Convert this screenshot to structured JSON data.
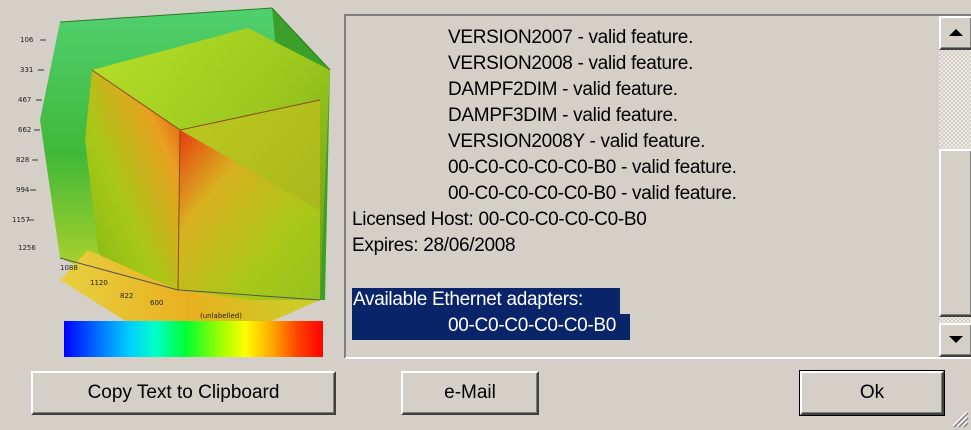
{
  "license_lines": [
    "VERSION2007 - valid feature.",
    "VERSION2008 - valid feature.",
    "DAMPF2DIM - valid feature.",
    "DAMPF3DIM - valid feature.",
    "VERSION2008Y - valid feature.",
    "00-C0-C0-C0-C0-B0 - valid feature.",
    "00-C0-C0-C0-C0-B0 - valid feature."
  ],
  "licensed_host": "Licensed Host:  00-C0-C0-C0-C0-B0",
  "expires": "Expires:   28/06/2008",
  "adapters_label": "Available Ethernet adapters:",
  "adapter_value": "00-C0-C0-C0-C0-B0",
  "buttons": {
    "copy": "Copy Text to Clipboard",
    "email": "e-Mail",
    "ok": "Ok"
  },
  "colors": {
    "selection": "#0a246a",
    "window_bg": "#d4d0c8"
  },
  "icons": [
    "scroll-up-arrow-icon",
    "scroll-down-arrow-icon",
    "resize-grip-icon"
  ]
}
